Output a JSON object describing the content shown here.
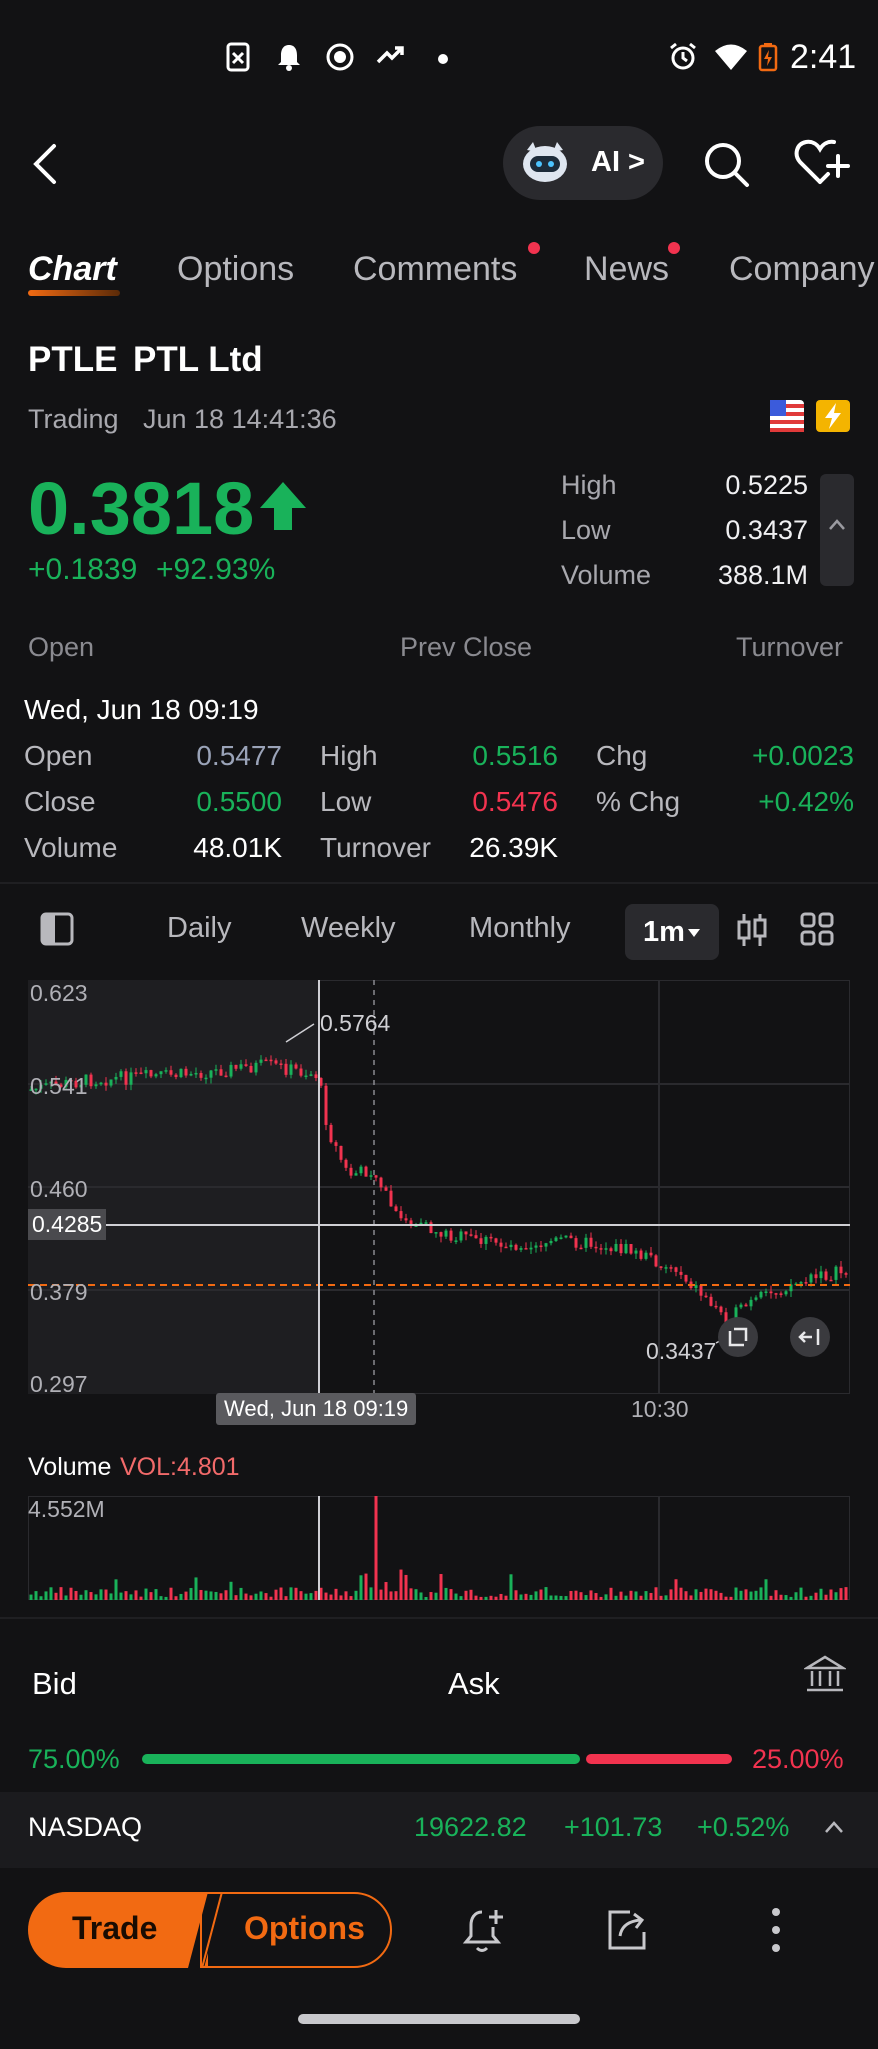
{
  "status_bar": {
    "time": "2:41"
  },
  "header": {
    "ai_label": "AI >"
  },
  "tabs": [
    {
      "label": "Chart",
      "active": true
    },
    {
      "label": "Options"
    },
    {
      "label": "Comments",
      "badge": true
    },
    {
      "label": "News",
      "badge": true
    },
    {
      "label": "Company"
    }
  ],
  "stock": {
    "symbol": "PTLE",
    "name": "PTL Ltd",
    "status": "Trading",
    "datetime": "Jun 18 14:41:36",
    "price": "0.3818",
    "change": "+0.1839",
    "change_pct": "+92.93%",
    "high_label": "High",
    "high": "0.5225",
    "low_label": "Low",
    "low": "0.3437",
    "volume_label": "Volume",
    "volume": "388.1M",
    "open_label": "Open",
    "prev_close_label": "Prev Close",
    "turnover_label": "Turnover"
  },
  "ohlc_popup": {
    "datetime": "Wed, Jun 18 09:19",
    "open_label": "Open",
    "open": "0.5477",
    "close_label": "Close",
    "close": "0.5500",
    "volume_label": "Volume",
    "volume": "48.01K",
    "high_label": "High",
    "high": "0.5516",
    "low_label": "Low",
    "low": "0.5476",
    "turnover_label": "Turnover",
    "turnover": "26.39K",
    "chg_label": "Chg",
    "chg": "+0.0023",
    "pct_chg_label": "% Chg",
    "pct_chg": "+0.42%"
  },
  "toolbar": {
    "daily": "Daily",
    "weekly": "Weekly",
    "monthly": "Monthly",
    "interval": "1m"
  },
  "chart": {
    "y_ticks": [
      "0.623",
      "0.541",
      "0.460",
      "0.379",
      "0.297"
    ],
    "crosshair_price": "0.4285",
    "max_marker": "0.5764",
    "min_marker": "0.3437",
    "crosshair_time": "Wed, Jun 18 09:19",
    "time_tick": "10:30"
  },
  "volume": {
    "title": "Volume",
    "vol_label": "VOL:4.801",
    "max_label": "4.552M"
  },
  "bid_ask": {
    "bid_label": "Bid",
    "ask_label": "Ask",
    "bid_pct": "75.00%",
    "ask_pct": "25.00%",
    "bid_fraction": 0.75
  },
  "index_strip": {
    "name": "NASDAQ",
    "value": "19622.82",
    "change": "+101.73",
    "change_pct": "+0.52%"
  },
  "bottom_bar": {
    "trade_label": "Trade",
    "options_label": "Options"
  },
  "colors": {
    "up": "#19b25a",
    "down": "#f2334f",
    "accent": "#f26a12"
  }
}
